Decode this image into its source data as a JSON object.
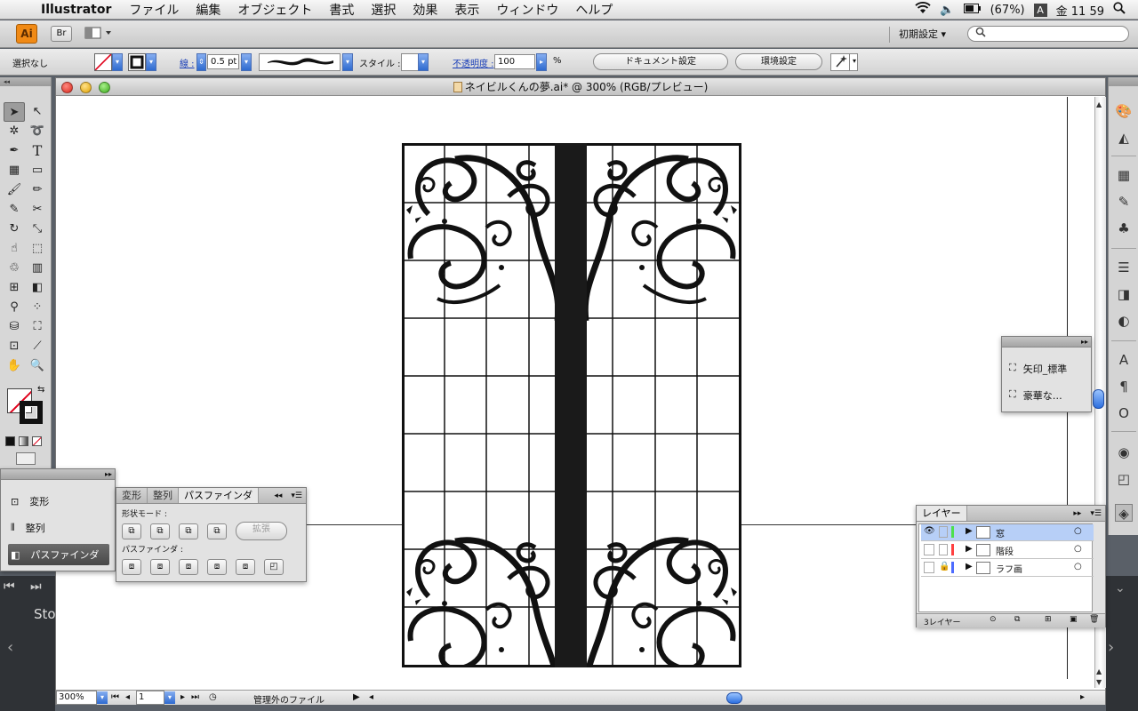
{
  "menubar": {
    "app": "Illustrator",
    "menus": [
      "ファイル",
      "編集",
      "オブジェクト",
      "書式",
      "選択",
      "効果",
      "表示",
      "ウィンドウ",
      "ヘルプ"
    ],
    "battery": "(67%)",
    "input": "A",
    "clock": "金 11 59"
  },
  "appbar": {
    "ai": "Ai",
    "br": "Br",
    "workspace": "初期設定 ▾"
  },
  "control": {
    "selection": "選択なし",
    "stroke_label": "線 :",
    "stroke_weight": "0.5 pt",
    "style_label": "スタイル :",
    "opacity_label": "不透明度 :",
    "opacity_value": "100",
    "percent": "%",
    "doc_setup": "ドキュメント設定",
    "prefs": "環境設定"
  },
  "document": {
    "title": "ネイビルくんの夢.ai* @ 300% (RGB/プレビュー)",
    "zoom": "300%",
    "page": "1",
    "status": "管理外のファイル"
  },
  "pathfinder": {
    "tabs": [
      "変形",
      "整列",
      "パスファインダ"
    ],
    "shape_modes": "形状モード :",
    "expand": "拡張",
    "pathfinders": "パスファインダ :"
  },
  "collapsed": {
    "items": [
      "変形",
      "整列",
      "パスファインダ"
    ]
  },
  "symbols": {
    "items": [
      "矢印_標準",
      "豪華な…"
    ]
  },
  "layers": {
    "tab": "レイヤー",
    "rows": [
      {
        "name": "窓",
        "color": "#4de04d"
      },
      {
        "name": "階段",
        "color": "#ff4040"
      },
      {
        "name": "ラフ画",
        "color": "#4d6bff"
      }
    ],
    "count": "3レイヤー"
  },
  "background": {
    "label": "Sto"
  }
}
